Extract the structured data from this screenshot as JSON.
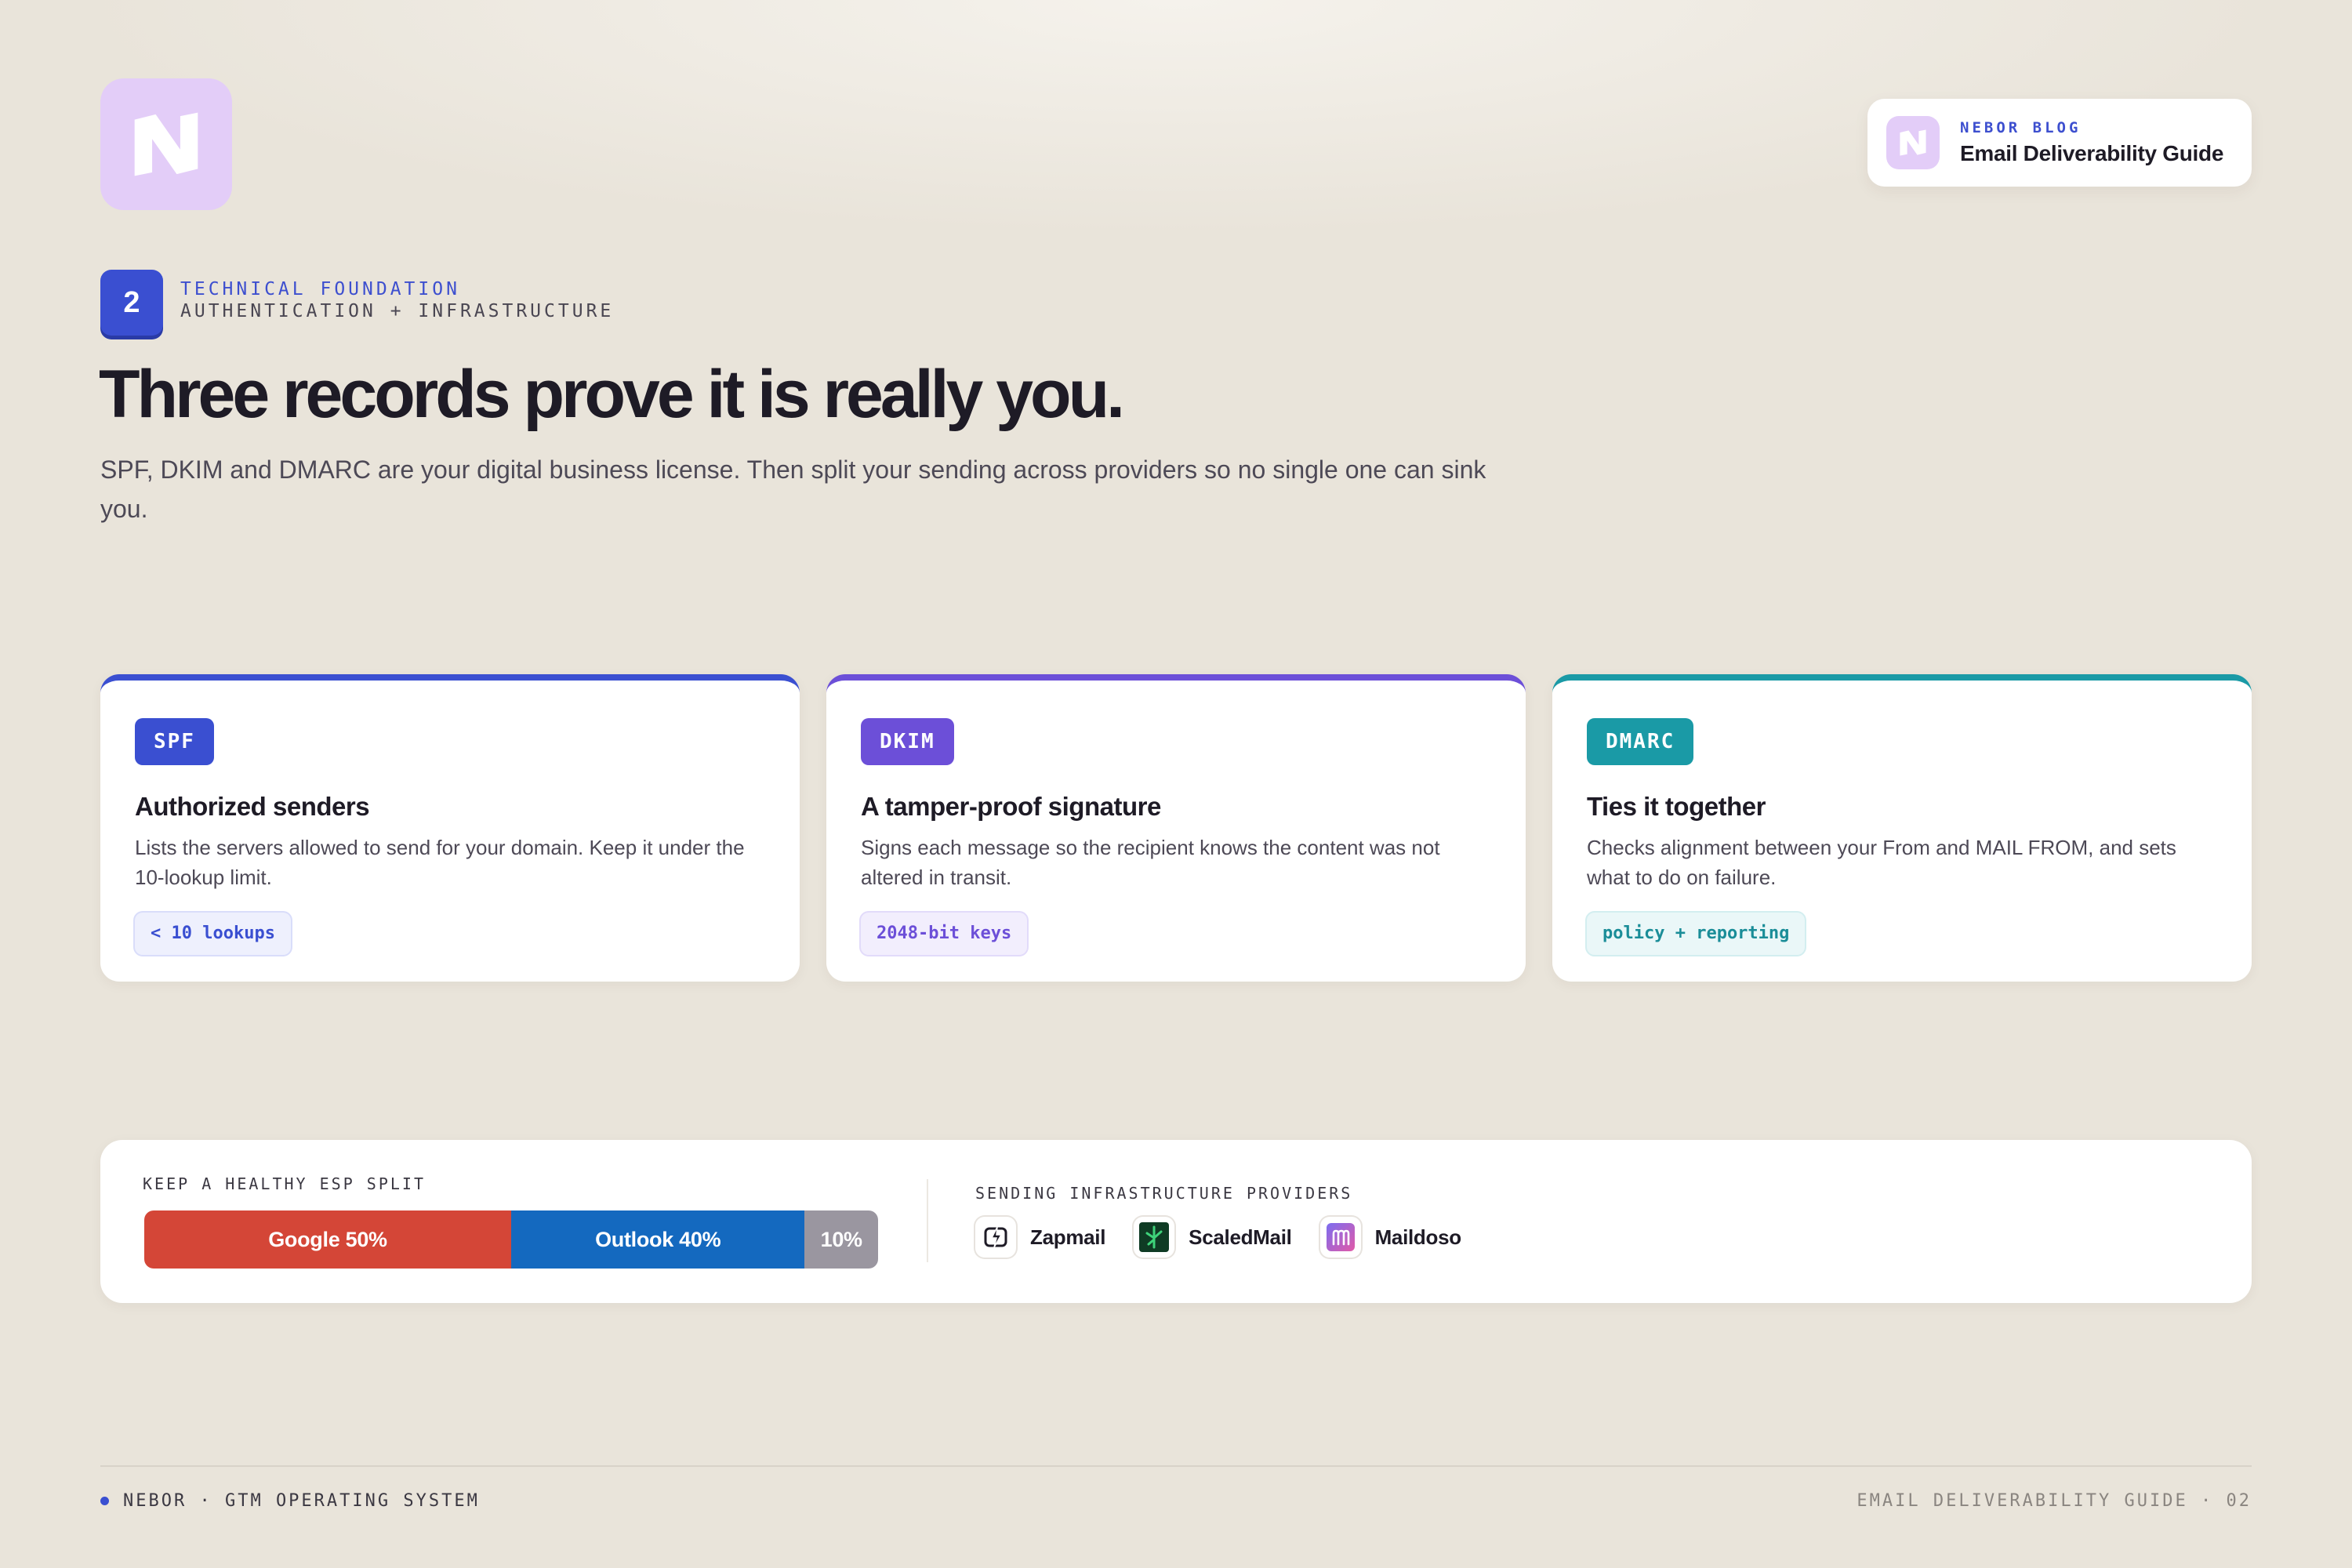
{
  "brand": {
    "logo_icon": "nebor-n-logo-icon",
    "badge_kicker": "NEBOR BLOG",
    "badge_title": "Email Deliverability Guide"
  },
  "section": {
    "number": "2",
    "kicker": "TECHNICAL FOUNDATION",
    "subtitle": "AUTHENTICATION + INFRASTRUCTURE"
  },
  "headline": "Three records prove it is really you.",
  "lede": "SPF, DKIM and DMARC are your digital business license. Then split your sending across providers so no single one can sink you.",
  "cards": [
    {
      "tag": "SPF",
      "title": "Authorized senders",
      "description": "Lists the servers allowed to send for your domain. Keep it under the 10-lookup limit.",
      "pill": "< 10 lookups",
      "accent": "#3a4fd1"
    },
    {
      "tag": "DKIM",
      "title": "A tamper-proof signature",
      "description": "Signs each message so the recipient knows the content was not altered in transit.",
      "pill": "2048-bit keys",
      "accent": "#6c4fd8"
    },
    {
      "tag": "DMARC",
      "title": "Ties it together",
      "description": "Checks alignment between your From and MAIL FROM, and sets what to do on failure.",
      "pill": "policy + reporting",
      "accent": "#1a9aa6"
    }
  ],
  "esp_split": {
    "label": "KEEP A HEALTHY ESP SPLIT",
    "segments": [
      {
        "label": "Google 50%",
        "value": 50,
        "color": "#d44637"
      },
      {
        "label": "Outlook 40%",
        "value": 40,
        "color": "#1469bf"
      },
      {
        "label": "10%",
        "value": 10,
        "color": "#9a96a0"
      }
    ]
  },
  "providers": {
    "label": "SENDING INFRASTRUCTURE PROVIDERS",
    "items": [
      {
        "name": "Zapmail",
        "icon": "zapmail-icon"
      },
      {
        "name": "ScaledMail",
        "icon": "scaledmail-icon"
      },
      {
        "name": "Maildoso",
        "icon": "maildoso-icon"
      }
    ]
  },
  "footer": {
    "left": "NEBOR · GTM OPERATING SYSTEM",
    "right": "EMAIL DELIVERABILITY GUIDE · 02"
  }
}
